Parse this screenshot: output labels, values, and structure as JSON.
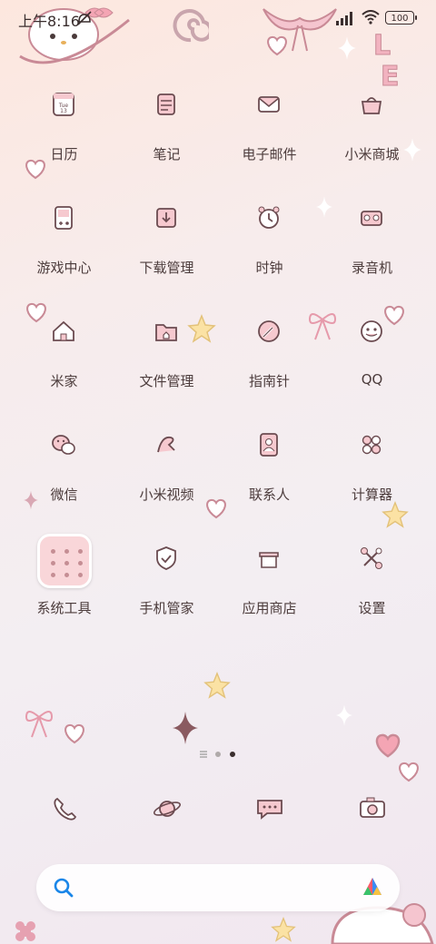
{
  "status_bar": {
    "time": "上午8:16",
    "battery": "100"
  },
  "apps": [
    {
      "label": "日历",
      "icon": "calendar-icon",
      "glyph": "Tue\n13"
    },
    {
      "label": "笔记",
      "icon": "notes-icon"
    },
    {
      "label": "电子邮件",
      "icon": "email-icon"
    },
    {
      "label": "小米商城",
      "icon": "shop-icon"
    },
    {
      "label": "游戏中心",
      "icon": "game-center-icon"
    },
    {
      "label": "下载管理",
      "icon": "download-icon"
    },
    {
      "label": "时钟",
      "icon": "clock-icon"
    },
    {
      "label": "录音机",
      "icon": "recorder-icon"
    },
    {
      "label": "米家",
      "icon": "home-icon"
    },
    {
      "label": "文件管理",
      "icon": "folder-icon"
    },
    {
      "label": "指南针",
      "icon": "compass-icon"
    },
    {
      "label": "QQ",
      "icon": "qq-icon"
    },
    {
      "label": "微信",
      "icon": "wechat-icon"
    },
    {
      "label": "小米视频",
      "icon": "video-icon"
    },
    {
      "label": "联系人",
      "icon": "contacts-icon"
    },
    {
      "label": "计算器",
      "icon": "calculator-icon"
    },
    {
      "label": "系统工具",
      "icon": "system-tools-folder"
    },
    {
      "label": "手机管家",
      "icon": "security-icon"
    },
    {
      "label": "应用商店",
      "icon": "app-store-icon"
    },
    {
      "label": "设置",
      "icon": "settings-icon"
    }
  ],
  "page_indicator": {
    "pages": 3,
    "current": 3
  },
  "dock": [
    {
      "icon": "phone-icon"
    },
    {
      "icon": "browser-icon"
    },
    {
      "icon": "messages-icon"
    },
    {
      "icon": "camera-icon"
    }
  ],
  "search": {
    "icon": "search-icon",
    "assistant_icon": "assistant-icon"
  },
  "colors": {
    "accent": "#e7a1ad",
    "icon_stroke": "#6b4b50",
    "icon_fill": "#f6c9cf"
  }
}
